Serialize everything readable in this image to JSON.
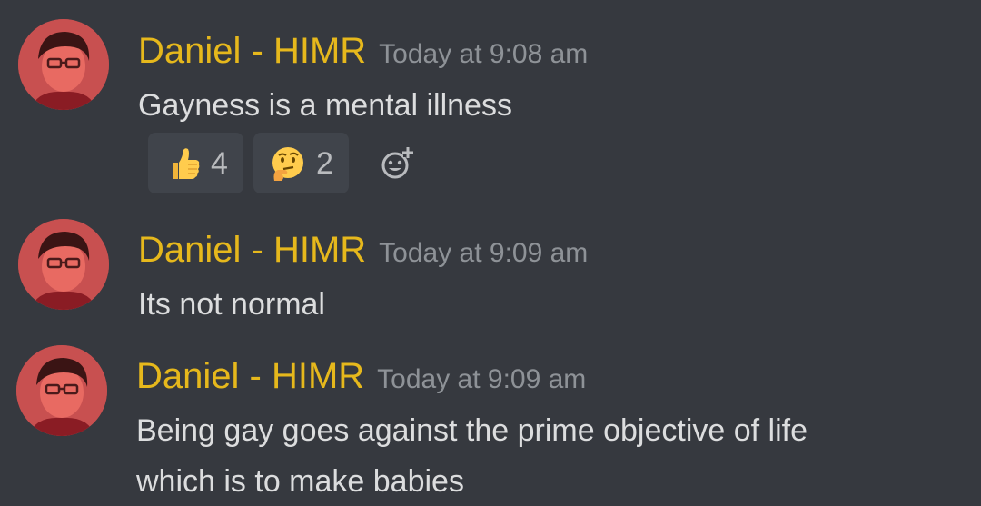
{
  "colors": {
    "background": "#36393f",
    "username": "#e6b81c",
    "timestamp": "#8e9297",
    "message_text": "#dcddde",
    "reaction_bg": "#40444b",
    "reaction_count": "#b9bbbe"
  },
  "messages": [
    {
      "author": "Daniel - HIMR",
      "timestamp": "Today at 9:08 am",
      "lines": [
        "Gayness is a mental illness"
      ],
      "reactions": [
        {
          "emoji": "thumbs-up",
          "count": "4"
        },
        {
          "emoji": "thinking-face",
          "count": "2"
        }
      ],
      "add_reaction_icon": "add-reaction-icon"
    },
    {
      "author": "Daniel - HIMR",
      "timestamp": "Today at 9:09 am",
      "lines": [
        "Its not normal"
      ]
    },
    {
      "author": "Daniel - HIMR",
      "timestamp": "Today at 9:09 am",
      "lines": [
        "Being gay goes against the prime objective of life",
        "which is to make babies"
      ]
    }
  ]
}
